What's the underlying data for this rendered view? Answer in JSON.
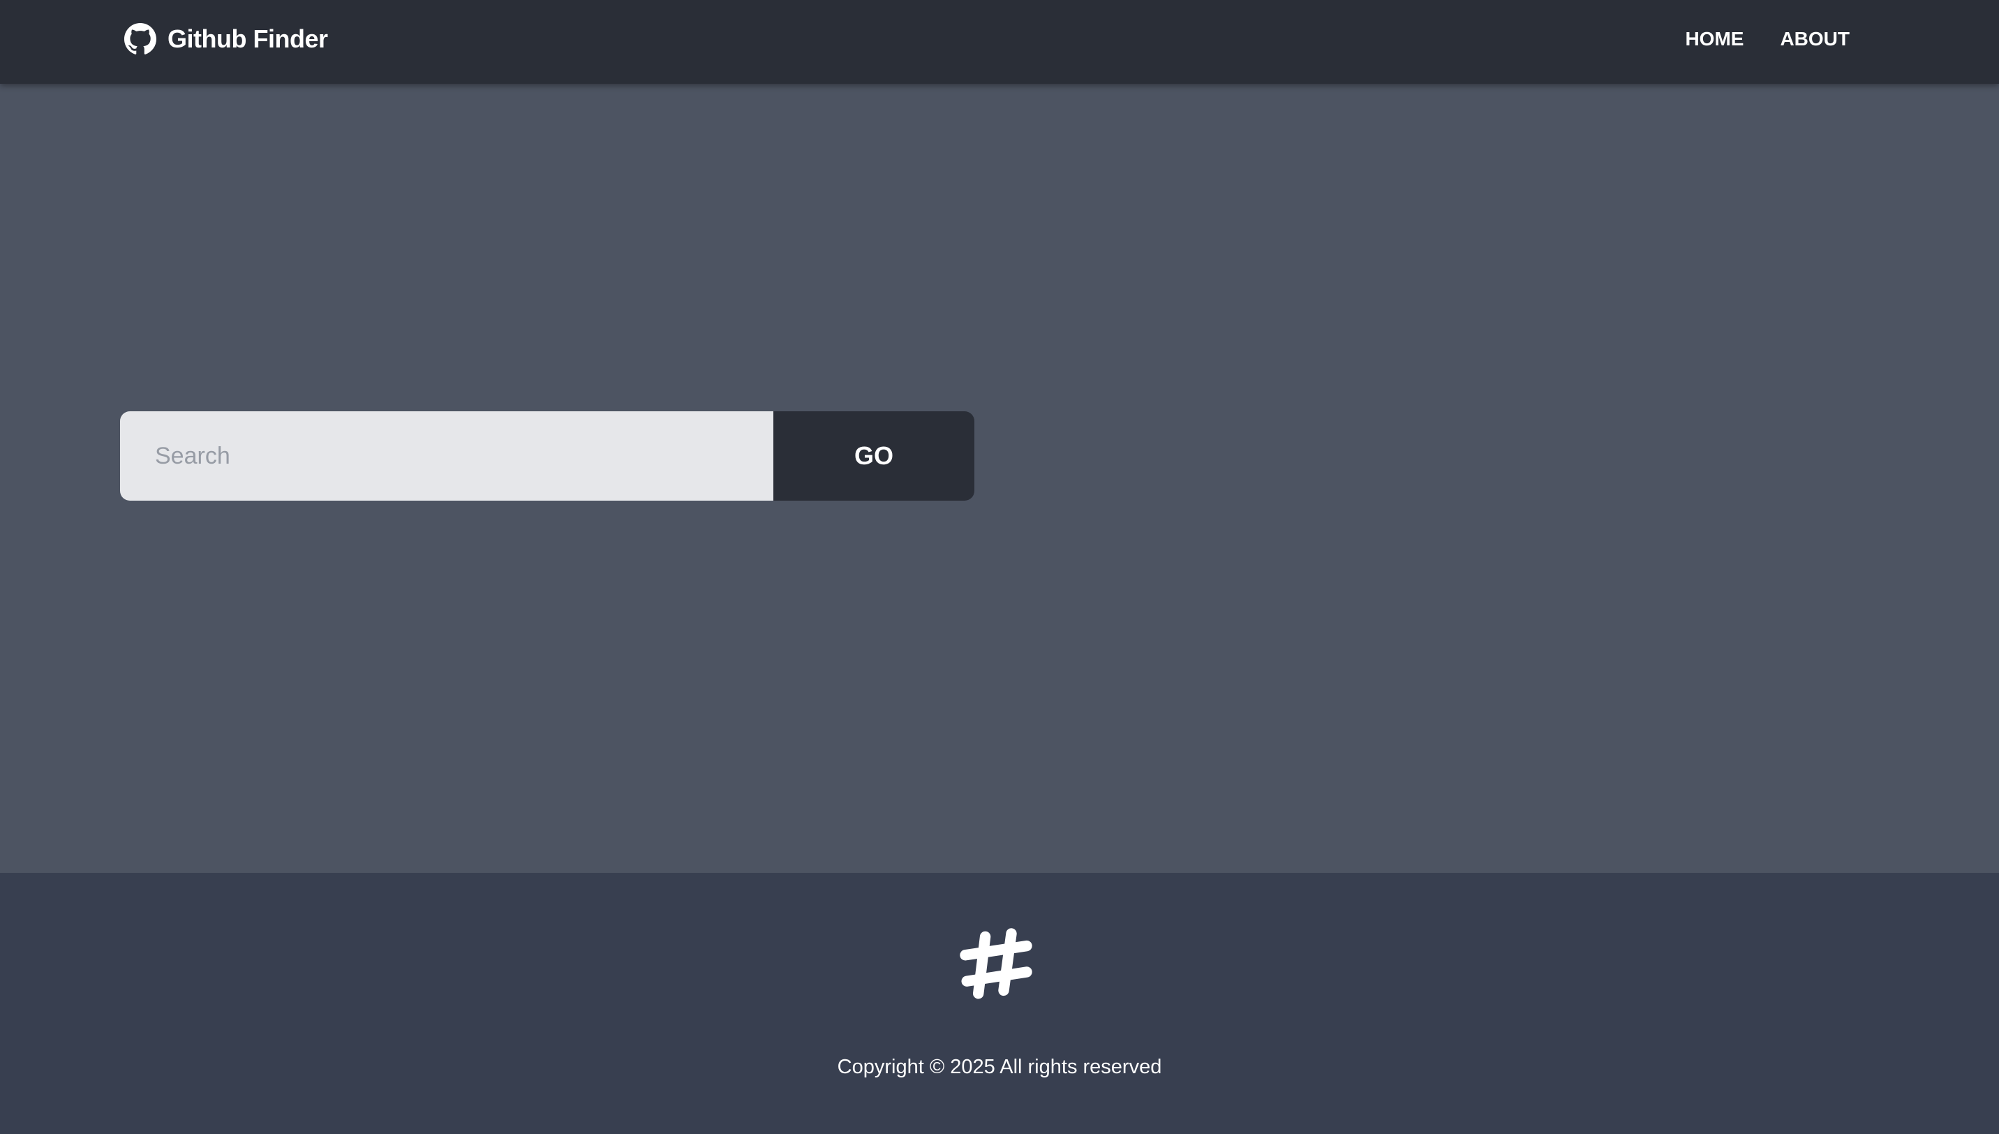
{
  "navbar": {
    "brand_icon": "github-icon",
    "brand_title": "Github Finder",
    "links": [
      {
        "label": "HOME"
      },
      {
        "label": "ABOUT"
      }
    ]
  },
  "search": {
    "placeholder": "Search",
    "value": "",
    "button_label": "GO"
  },
  "footer": {
    "logo_icon": "hashtag-logo-icon",
    "copyright": "Copyright © 2025 All rights reserved"
  },
  "colors": {
    "navbar_bg": "#2a2e37",
    "page_bg": "#4d5462",
    "footer_bg": "#383f50",
    "input_bg": "#e6e7ea",
    "button_bg": "#2a2e37",
    "text_light": "#ffffff"
  }
}
